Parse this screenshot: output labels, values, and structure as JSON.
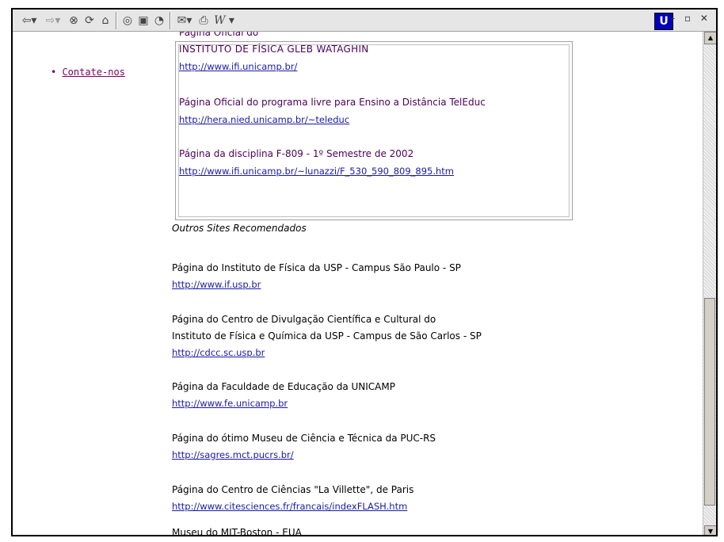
{
  "sidebar": {
    "contact_link": "Contate-nos"
  },
  "logo_letter": "U",
  "window_controls": "– ▫ ✕",
  "box": {
    "items": [
      {
        "line1": "Página Oficial do",
        "line2": "INSTITUTO DE FÍSICA GLEB WATAGHIN",
        "url": "http://www.ifi.unicamp.br/"
      },
      {
        "line1": "Página Oficial do programa livre para Ensino a Distância TelEduc",
        "url": "http://hera.nied.unicamp.br/~teleduc"
      },
      {
        "line1": "Página da disciplina F-809 - 1º Semestre de 2002",
        "url": "http://www.ifi.unicamp.br/~lunazzi/F_530_590_809_895.htm"
      }
    ]
  },
  "others": {
    "heading": "Outros Sites Recomendados",
    "items": [
      {
        "lines": [
          "Página do Instituto de Física da USP - Campus São Paulo - SP"
        ],
        "url": "http://www.if.usp.br"
      },
      {
        "lines": [
          "Página do Centro de Divulgação Científica e Cultural do",
          "Instituto de Física e Química da USP - Campus de São Carlos - SP"
        ],
        "url": "http://cdcc.sc.usp.br"
      },
      {
        "lines": [
          "Página da Faculdade de Educação da UNICAMP"
        ],
        "url": "http://www.fe.unicamp.br"
      },
      {
        "lines": [
          "Página do ótimo Museu de Ciência e Técnica da PUC-RS"
        ],
        "url": "http://sagres.mct.pucrs.br/"
      },
      {
        "lines": [
          "Página do Centro de Ciências \"La Villette\", de Paris"
        ],
        "url": "http://www.citesciences.fr/francais/indexFLASH.htm"
      },
      {
        "lines": [
          "Museu do MIT-Boston - EUA"
        ]
      }
    ]
  }
}
